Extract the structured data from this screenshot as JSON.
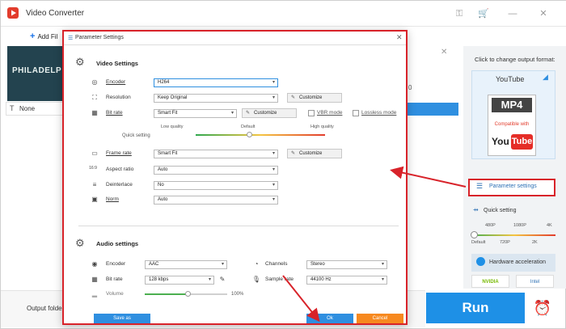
{
  "app": {
    "title": "Video Converter",
    "add_files": "Add Fil",
    "thumb_text": "PHILADELP",
    "file_name": "None",
    "partial_text": "0",
    "output_folder_label": "Output folder",
    "run_label": "Run",
    "accent": "#1e90e6"
  },
  "right_panel": {
    "title": "Click to change output format:",
    "format_name": "YouTube",
    "mp4_label": "MP4",
    "compat_text": "Compatible with",
    "yt_you": "You",
    "yt_tube": "Tube",
    "param_settings": "Parameter settings",
    "quick_setting": "Quick setting",
    "qs_top_labels": [
      "480P",
      "1080P",
      "4K"
    ],
    "qs_bottom_labels": [
      "Default",
      "720P",
      "2K"
    ],
    "hw_accel": "Hardware acceleration",
    "gpu_nvidia": "NVIDIA",
    "gpu_intel": "Intel"
  },
  "dialog": {
    "title": "Parameter Settings",
    "video_settings_title": "Video Settings",
    "audio_settings_title": "Audio settings",
    "encoder_label": "Encoder",
    "encoder_value": "H264",
    "resolution_label": "Resolution",
    "resolution_value": "Keep Original",
    "bitrate_label": "Bit rate",
    "bitrate_value": "Smart Fit",
    "customize": "Customize",
    "vbr_mode": "VBR mode",
    "lossless_mode": "Lossless mode",
    "quick_setting": "Quick setting",
    "low_quality": "Low quality",
    "default": "Default",
    "high_quality": "High quality",
    "framerate_label": "Frame rate",
    "framerate_value": "Smart Fit",
    "aspect_label": "Aspect ratio",
    "aspect_value": "Auto",
    "deinterlace_label": "Deinterlace",
    "deinterlace_value": "No",
    "norm_label": "Norm",
    "norm_value": "Auto",
    "a_encoder_label": "Encoder",
    "a_encoder_value": "AAC",
    "a_bitrate_label": "Bit rate",
    "a_bitrate_value": "128 kbps",
    "volume_label": "Volume",
    "volume_value": "100%",
    "channels_label": "Channels",
    "channels_value": "Stereo",
    "samplerate_label": "Sample rate",
    "samplerate_value": "44100 Hz",
    "save_as": "Save as",
    "ok": "Ok",
    "cancel": "Cancel"
  },
  "colors": {
    "highlight_red": "#d8232a",
    "ok_blue": "#2f8fe0",
    "cancel_orange": "#f7891f"
  }
}
